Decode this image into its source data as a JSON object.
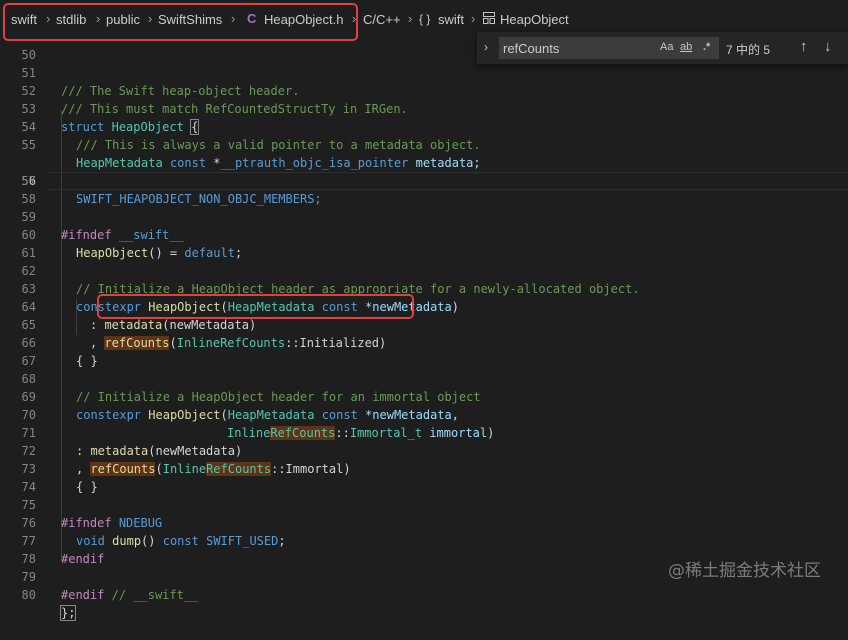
{
  "breadcrumbs": {
    "items": [
      "swift",
      "stdlib",
      "public",
      "SwiftShims",
      "HeapObject.h",
      "C/C++",
      "swift",
      "HeapObject"
    ],
    "c_badge": "C",
    "braces": "{ }"
  },
  "find_widget": {
    "query": "refCounts",
    "match_case": "Aa",
    "whole_word": "ab",
    "regex": ".*",
    "count": "7 中的 5"
  },
  "watermark": "@稀土掘金技术社区",
  "line_numbers": [
    "50",
    "51",
    "52",
    "53",
    "54",
    "55",
    "56",
    "57",
    "58",
    "59",
    "60",
    "61",
    "62",
    "63",
    "64",
    "65",
    "66",
    "67",
    "68",
    "69",
    "70",
    "71",
    "72",
    "73",
    "74",
    "75",
    "76",
    "77",
    "78",
    "79",
    "80"
  ],
  "colors": {
    "accent_highlight": "#e04040",
    "match_bg": "#613214"
  },
  "code": {
    "l51": "/// The Swift heap-object header.",
    "l52": "/// This must match RefCountedStructTy in IRGen.",
    "l53a": "struct",
    "l53b": "HeapObject",
    "l53c": "{",
    "l54": "/// This is always a valid pointer to a metadata object.",
    "l55a": "HeapMetadata",
    "l55b": "const",
    "l55c": "*",
    "l55d": "__ptrauth_objc_isa_pointer",
    "l55e": "metadata;",
    "l57": "SWIFT_HEAPOBJECT_NON_OBJC_MEMBERS;",
    "l59a": "#ifndef",
    "l59b": "__swift__",
    "l60a": "HeapObject",
    "l60b": "() = ",
    "l60c": "default",
    "l60d": ";",
    "l62": "// Initialize a HeapObject header as appropriate for a newly-allocated object.",
    "l63a": "constexpr",
    "l63b": "HeapObject",
    "l63c": "(",
    "l63d": "HeapMetadata",
    "l63e": "const",
    "l63f": "*newMetadata",
    "l63g": ")",
    "l64a": ": ",
    "l64b": "metadata",
    "l64c": "(newMetadata)",
    "l65a": ", ",
    "l65b": "refCounts",
    "l65c": "(",
    "l65d": "InlineRefCounts",
    "l65e": "::Initialized)",
    "l66": "{ }",
    "l68": "// Initialize a HeapObject header for an immortal object",
    "l69a": "constexpr",
    "l69b": "HeapObject",
    "l69c": "(",
    "l69d": "HeapMetadata",
    "l69e": "const",
    "l69f": "*newMetadata",
    "l69g": ",",
    "l70a": "Inline",
    "l70b": "RefCounts",
    "l70c": "::",
    "l70d": "Immortal_t",
    "l70e": "immortal",
    "l70f": ")",
    "l71a": ": ",
    "l71b": "metadata",
    "l71c": "(newMetadata)",
    "l72a": ", ",
    "l72b": "refCounts",
    "l72c": "(",
    "l72d": "Inline",
    "l72e": "RefCounts",
    "l72f": "::Immortal)",
    "l73": "{ }",
    "l75a": "#ifndef",
    "l75b": "NDEBUG",
    "l76a": "void",
    "l76b": "dump",
    "l76c": "() ",
    "l76d": "const",
    "l76e": "SWIFT_USED",
    "l76f": ";",
    "l77": "#endif",
    "l79a": "#endif",
    "l79b": "// __swift__",
    "l80": "};"
  }
}
